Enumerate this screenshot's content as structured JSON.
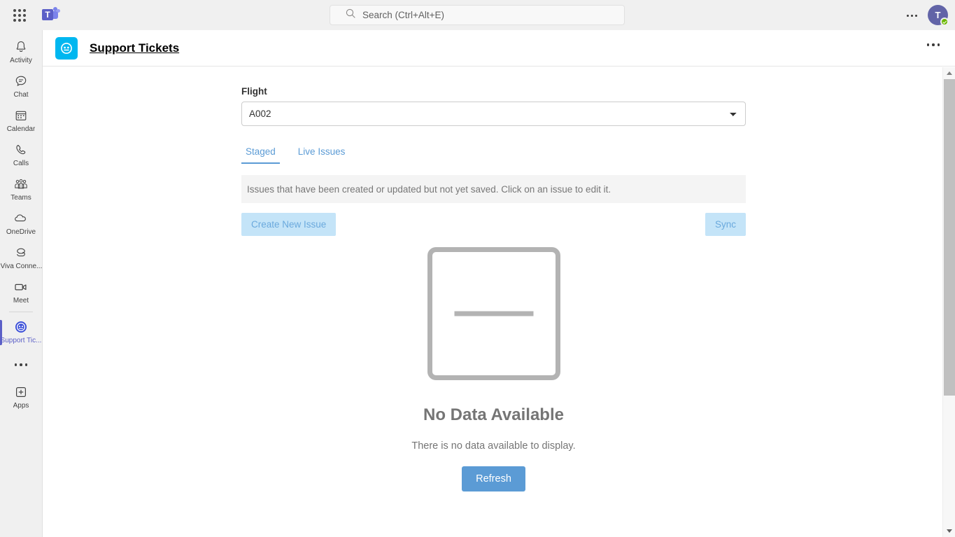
{
  "topbar": {
    "waffle_label": "app-launcher",
    "teams_logo_letter": "T",
    "search": {
      "placeholder": "Search (Ctrl+Alt+E)",
      "value": ""
    },
    "more_label": "…",
    "avatar_initial": "T",
    "presence": "available"
  },
  "rail": {
    "items": [
      {
        "label": "Activity",
        "icon": "bell-icon",
        "active": false
      },
      {
        "label": "Chat",
        "icon": "chat-icon",
        "active": false
      },
      {
        "label": "Calendar",
        "icon": "calendar-icon",
        "active": false
      },
      {
        "label": "Calls",
        "icon": "phone-icon",
        "active": false
      },
      {
        "label": "Teams",
        "icon": "teams-icon",
        "active": false
      },
      {
        "label": "OneDrive",
        "icon": "cloud-icon",
        "active": false
      },
      {
        "label": "Viva Conne...",
        "icon": "viva-connections-icon",
        "active": false
      },
      {
        "label": "Meet",
        "icon": "video-camera-icon",
        "active": false
      },
      {
        "label": "Support Tic...",
        "icon": "support-tickets-icon",
        "active": true
      }
    ],
    "more_label": "…",
    "apps_label": "Apps",
    "apps_icon": "plus-square-icon"
  },
  "app_header": {
    "icon": "support-tickets-icon",
    "title": "Support Tickets",
    "more_label": "…"
  },
  "main": {
    "flight": {
      "label": "Flight",
      "selected": "A002",
      "options": [
        "A002"
      ]
    },
    "tabs": [
      {
        "label": "Staged",
        "active": true
      },
      {
        "label": "Live Issues",
        "active": false
      }
    ],
    "info_banner": "Issues that have been created or updated but not yet saved. Click on an issue to edit it.",
    "buttons": {
      "create_new_issue": "Create New Issue",
      "sync": "Sync"
    },
    "empty_state": {
      "illustration": "no-data-placeholder-icon",
      "title": "No Data Available",
      "subtitle": "There is no data available to display.",
      "refresh_label": "Refresh"
    }
  },
  "colors": {
    "teams_purple": "#5b5fc7",
    "app_cyan": "#00b7f0",
    "accent_blue": "#5b9bd5",
    "disabled_blue_bg": "#c4e4f8",
    "disabled_blue_text": "#6aa9dd",
    "presence_green": "#6bb700",
    "empty_gray": "#b3b3b3"
  }
}
